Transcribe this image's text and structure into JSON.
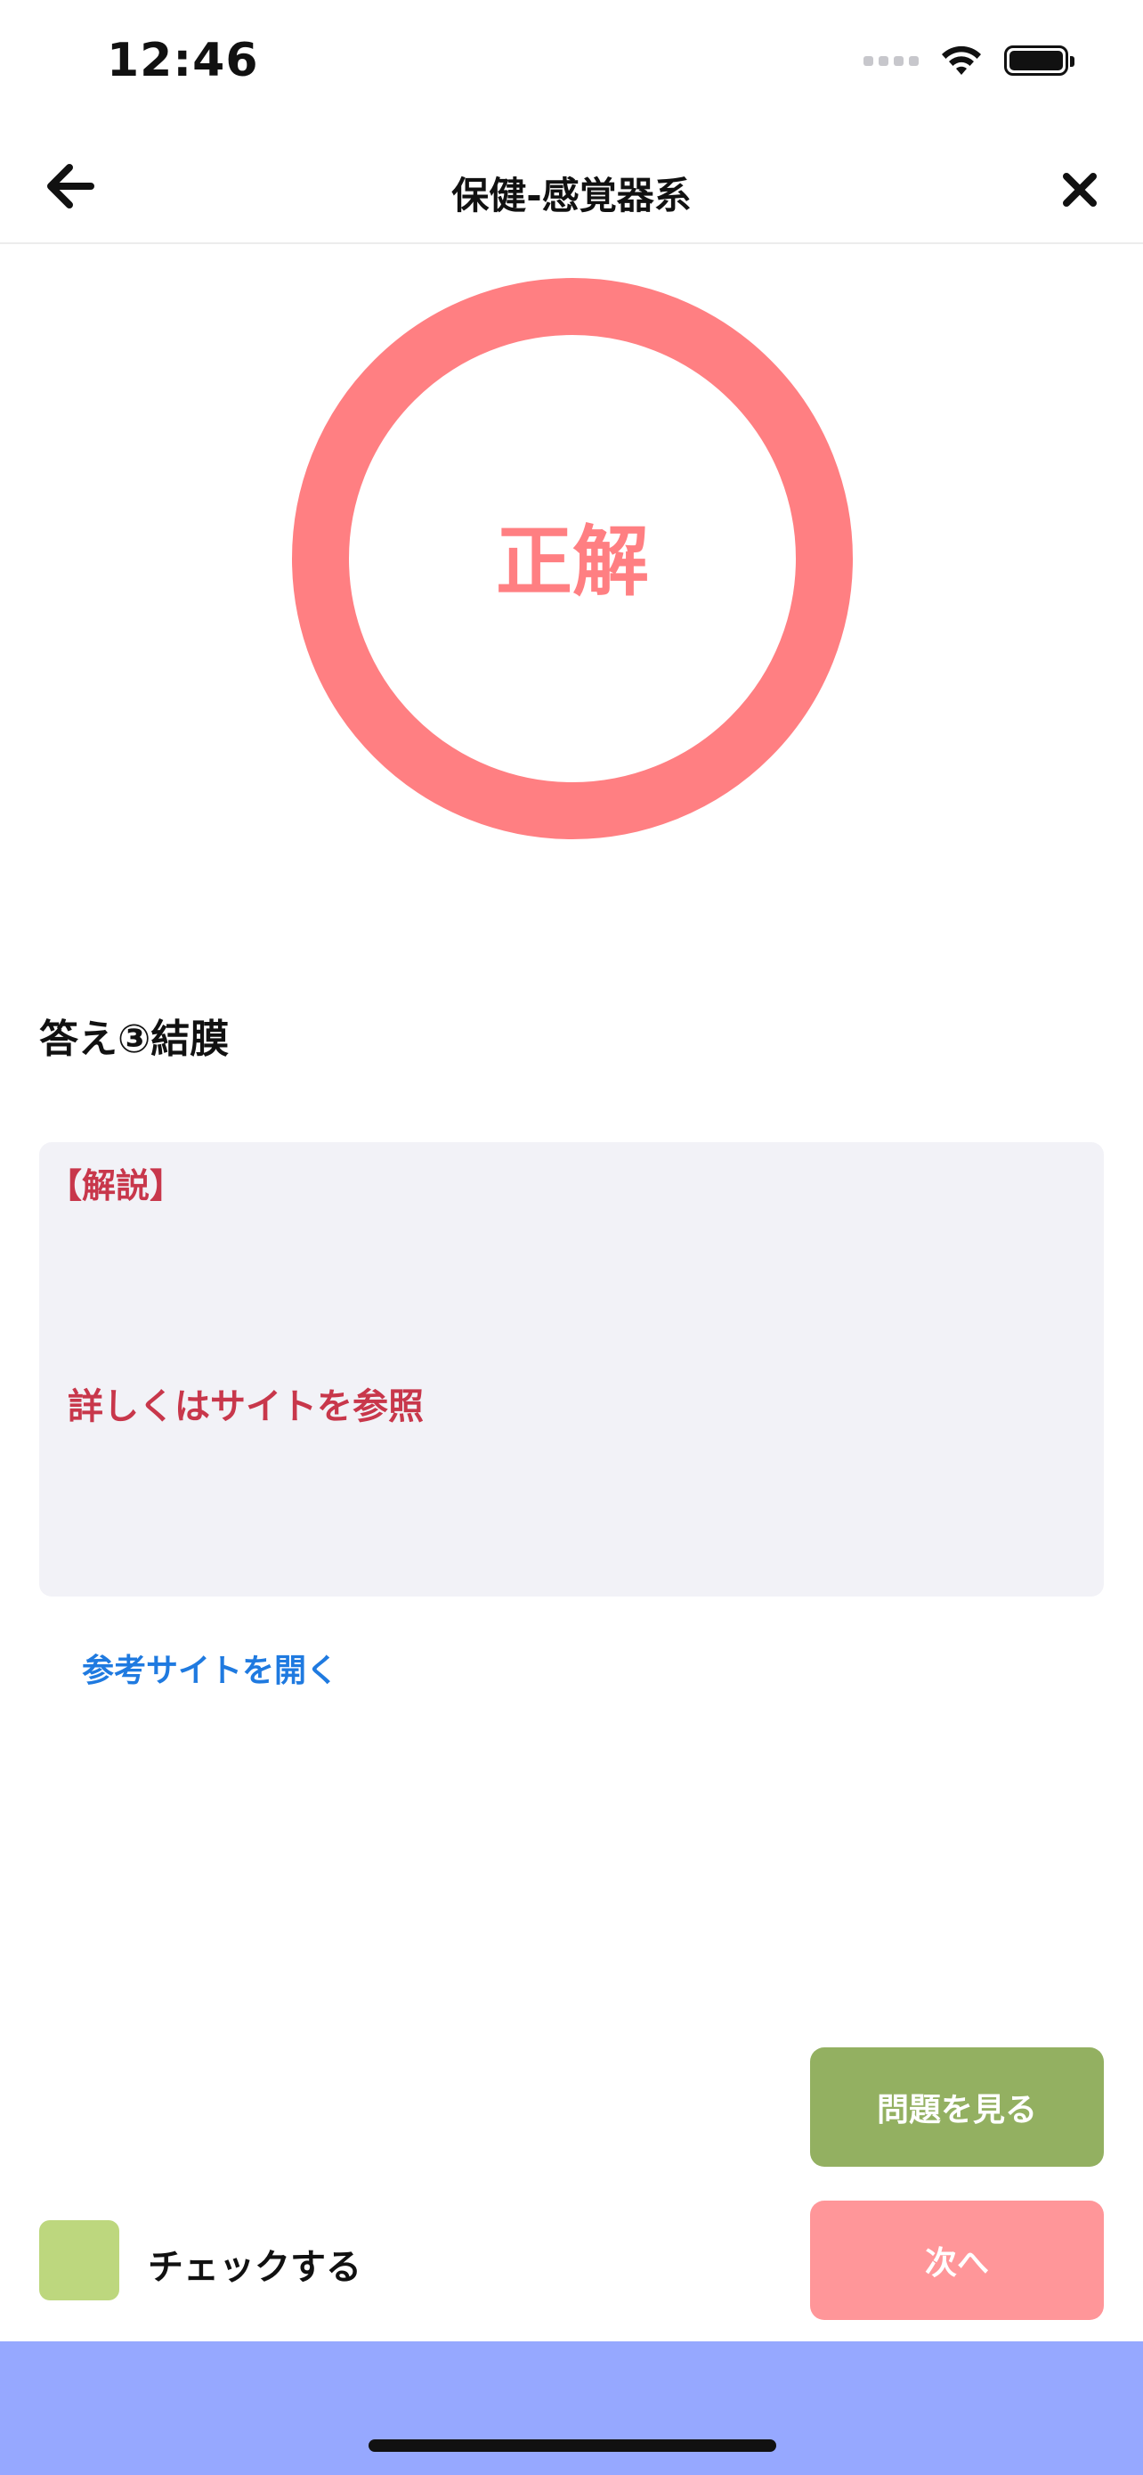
{
  "status_bar": {
    "time": "12:46"
  },
  "nav": {
    "title": "保健-感覚器系",
    "back_icon": "arrow-left-icon",
    "close_icon": "close-icon"
  },
  "result": {
    "label": "正解",
    "color": "#ff7f82"
  },
  "answer": {
    "text": "答え③結膜"
  },
  "explanation": {
    "heading": "【解説】",
    "body": "詳しくはサイトを参照",
    "text_color": "#c8374b"
  },
  "reference_link": {
    "label": "参考サイトを開く"
  },
  "actions": {
    "view_question_label": "問題を見る",
    "next_label": "次へ",
    "check_label": "チェックする"
  },
  "colors": {
    "view_question": "#93b061",
    "next": "#ff9699",
    "check_box": "#bdd77e",
    "bottom_bar": "#96a8ff",
    "link": "#1f7ae0"
  }
}
